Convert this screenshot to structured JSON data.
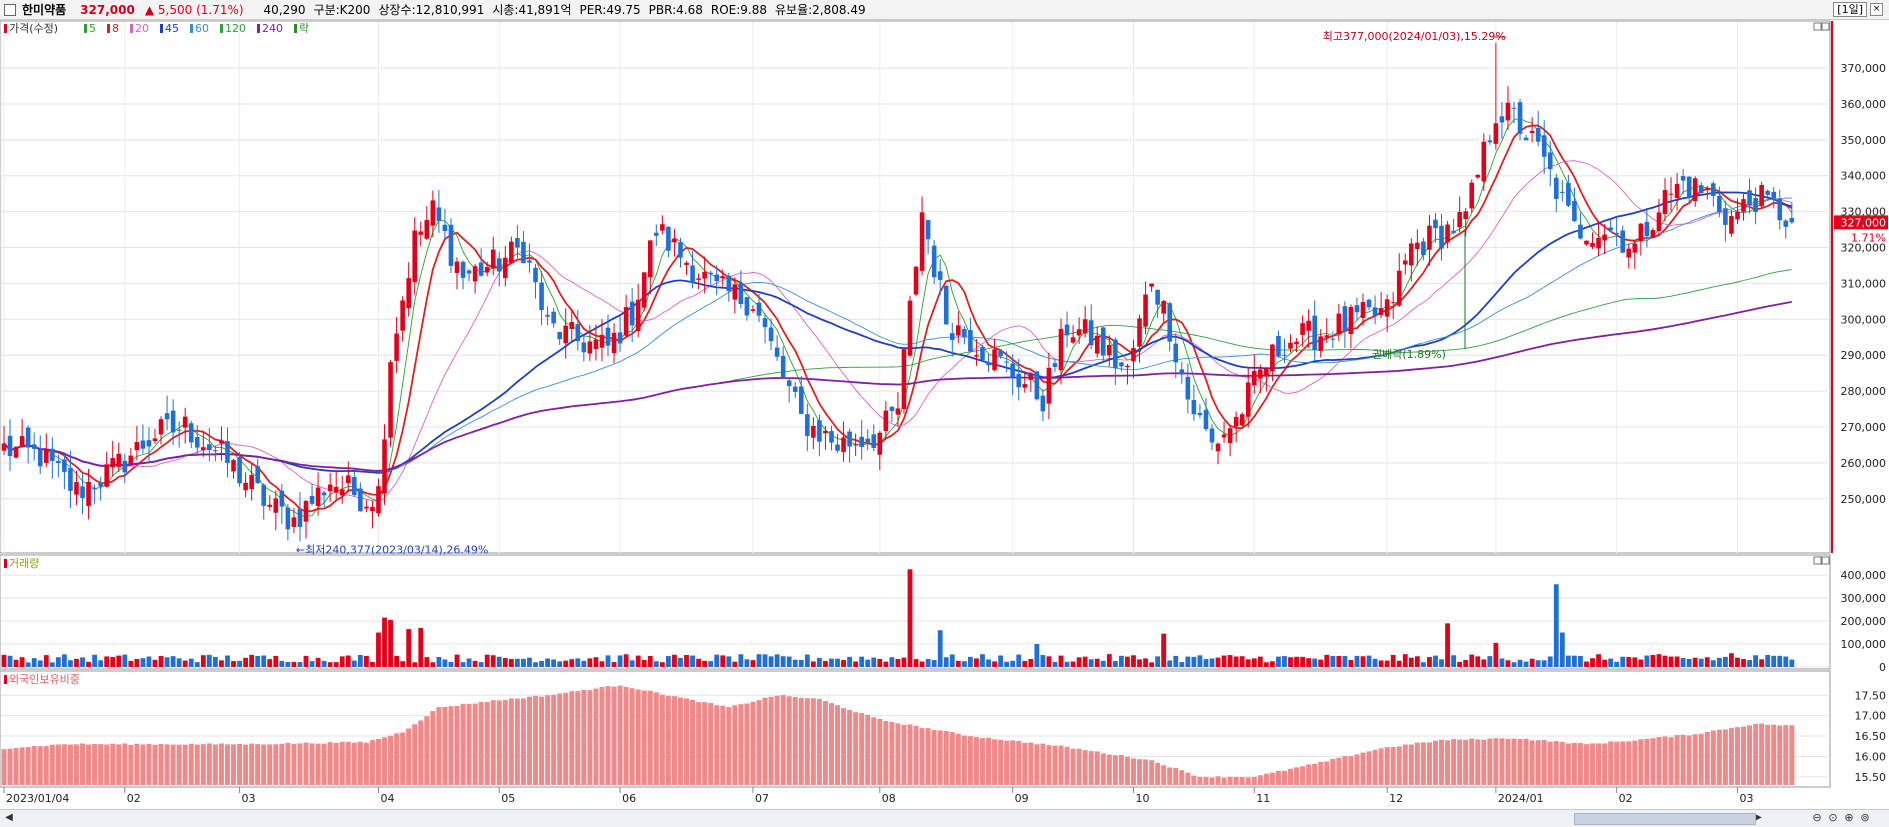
{
  "header": {
    "name": "한미약품",
    "price": "327,000",
    "change": "▲ 5,500",
    "change_pct": "(1.71%)",
    "volume": "40,290",
    "category": "구분:K200",
    "shares": "상장수:12,810,991",
    "market_cap": "시총:41,891억",
    "per": "PER:49.75",
    "pbr": "PBR:4.68",
    "roe": "ROE:9.88",
    "float_ratio": "유보율:2,808.49",
    "period": "[1일]"
  },
  "legend": {
    "price_label": "가격(수정)",
    "ma": [
      {
        "label": "5",
        "color": "#2ca02c"
      },
      {
        "label": "8",
        "color": "#e02020"
      },
      {
        "label": "20",
        "color": "#e060c0"
      },
      {
        "label": "45",
        "color": "#1f3fbf"
      },
      {
        "label": "60",
        "color": "#3a8fd0"
      },
      {
        "label": "120",
        "color": "#30a040"
      },
      {
        "label": "240",
        "color": "#8020a0"
      }
    ],
    "lock_label": "락",
    "volume_label": "거래량",
    "foreign_label": "외국인보유비중"
  },
  "annotations": {
    "high": "최고377,000(2024/01/03),15.29%",
    "low": "←최저240,377(2023/03/14),26.49%",
    "rights": "권배락(1.89%)",
    "last_price_tag": "327,000",
    "last_pct_tag": "1.71%"
  },
  "colors": {
    "up": "#e3001b",
    "down": "#1f6fd6",
    "foreign_bar": "#f08a8a",
    "grid": "#e4e4e4"
  },
  "chart_data": [
    {
      "type": "candlestick",
      "title": "가격(수정)",
      "ylim": [
        236000,
        382000
      ],
      "yticks": [
        250000,
        260000,
        270000,
        280000,
        290000,
        300000,
        310000,
        320000,
        330000,
        340000,
        350000,
        360000,
        370000
      ],
      "ytick_labels": [
        "250,000",
        "260,000",
        "270,000",
        "280,000",
        "290,000",
        "300,000",
        "310,000",
        "320,000",
        "330,000",
        "340,000",
        "350,000",
        "360,000",
        "370,000"
      ],
      "xticks": [
        "2023/01/04",
        "02",
        "03",
        "04",
        "05",
        "06",
        "07",
        "08",
        "09",
        "10",
        "11",
        "12",
        "2024/01",
        "02",
        "03"
      ],
      "xtick_index": [
        0,
        20,
        39,
        62,
        82,
        102,
        124,
        145,
        167,
        187,
        207,
        229,
        247,
        267,
        287
      ],
      "n": 297,
      "anchors": [
        [
          0,
          264000
        ],
        [
          6,
          262000
        ],
        [
          12,
          252000
        ],
        [
          18,
          258000
        ],
        [
          25,
          268000
        ],
        [
          30,
          270000
        ],
        [
          36,
          262000
        ],
        [
          44,
          248000
        ],
        [
          48,
          244000
        ],
        [
          54,
          255000
        ],
        [
          60,
          250000
        ],
        [
          62,
          252000
        ],
        [
          64,
          290000
        ],
        [
          68,
          322000
        ],
        [
          71,
          330000
        ],
        [
          76,
          312000
        ],
        [
          82,
          316000
        ],
        [
          86,
          320000
        ],
        [
          90,
          298000
        ],
        [
          95,
          294000
        ],
        [
          100,
          292000
        ],
        [
          104,
          302000
        ],
        [
          108,
          325000
        ],
        [
          112,
          318000
        ],
        [
          118,
          308000
        ],
        [
          124,
          305000
        ],
        [
          128,
          288000
        ],
        [
          132,
          272000
        ],
        [
          138,
          265000
        ],
        [
          145,
          268000
        ],
        [
          148,
          275000
        ],
        [
          152,
          330000
        ],
        [
          156,
          300000
        ],
        [
          162,
          292000
        ],
        [
          167,
          285000
        ],
        [
          172,
          278000
        ],
        [
          176,
          298000
        ],
        [
          180,
          295000
        ],
        [
          186,
          285000
        ],
        [
          190,
          312000
        ],
        [
          193,
          298000
        ],
        [
          196,
          278000
        ],
        [
          200,
          265000
        ],
        [
          204,
          272000
        ],
        [
          208,
          285000
        ],
        [
          212,
          294000
        ],
        [
          218,
          296000
        ],
        [
          224,
          300000
        ],
        [
          229,
          302000
        ],
        [
          233,
          320000
        ],
        [
          238,
          324000
        ],
        [
          242,
          328000
        ],
        [
          247,
          358000
        ],
        [
          250,
          356000
        ],
        [
          254,
          347000
        ],
        [
          256,
          340000
        ],
        [
          260,
          325000
        ],
        [
          266,
          325000
        ],
        [
          270,
          320000
        ],
        [
          274,
          332000
        ],
        [
          278,
          338000
        ],
        [
          282,
          335000
        ],
        [
          286,
          328000
        ],
        [
          290,
          334000
        ],
        [
          294,
          330000
        ],
        [
          296,
          327000
        ]
      ],
      "high": {
        "index": 247,
        "value": 377000,
        "date": "2024/01/03"
      },
      "low": {
        "index": 48,
        "value": 240377,
        "date": "2023/03/14"
      },
      "last": 327000,
      "series_ma": [
        {
          "name": "5",
          "period": 5,
          "color": "#2ca02c",
          "width": 0.9
        },
        {
          "name": "8",
          "period": 8,
          "color": "#e02020",
          "width": 1.8
        },
        {
          "name": "20",
          "period": 20,
          "color": "#e060c0",
          "width": 0.9
        },
        {
          "name": "45",
          "period": 45,
          "color": "#1f3fbf",
          "width": 1.8
        },
        {
          "name": "60",
          "period": 60,
          "color": "#3a8fd0",
          "width": 0.9
        },
        {
          "name": "120",
          "period": 120,
          "color": "#30a040",
          "width": 0.9
        },
        {
          "name": "240",
          "period": 240,
          "color": "#8020a0",
          "width": 1.8
        }
      ]
    },
    {
      "type": "bar",
      "title": "거래량",
      "ylim": [
        0,
        470000
      ],
      "yticks": [
        0,
        100000,
        200000,
        300000,
        400000
      ],
      "ytick_labels": [
        "0",
        "100,000",
        "200,000",
        "300,000",
        "400,000"
      ],
      "base": 40000,
      "spikes": [
        [
          62,
          150000
        ],
        [
          63,
          215000
        ],
        [
          64,
          205000
        ],
        [
          67,
          165000
        ],
        [
          69,
          170000
        ],
        [
          150,
          425000
        ],
        [
          155,
          160000
        ],
        [
          171,
          100000
        ],
        [
          192,
          145000
        ],
        [
          239,
          190000
        ],
        [
          247,
          105000
        ],
        [
          257,
          360000
        ],
        [
          258,
          150000
        ],
        [
          286,
          60000
        ]
      ]
    },
    {
      "type": "bar",
      "title": "외국인보유비중",
      "ylim": [
        15.3,
        17.85
      ],
      "yticks": [
        15.5,
        16.0,
        16.5,
        17.0,
        17.5
      ],
      "ytick_labels": [
        "15.50",
        "16.00",
        "16.50",
        "17.00",
        "17.50"
      ],
      "anchors": [
        [
          0,
          16.2
        ],
        [
          10,
          16.3
        ],
        [
          40,
          16.3
        ],
        [
          60,
          16.35
        ],
        [
          66,
          16.6
        ],
        [
          72,
          17.2
        ],
        [
          80,
          17.35
        ],
        [
          90,
          17.5
        ],
        [
          102,
          17.75
        ],
        [
          110,
          17.5
        ],
        [
          120,
          17.2
        ],
        [
          128,
          17.5
        ],
        [
          135,
          17.4
        ],
        [
          145,
          16.9
        ],
        [
          160,
          16.5
        ],
        [
          175,
          16.25
        ],
        [
          190,
          15.9
        ],
        [
          198,
          15.5
        ],
        [
          207,
          15.5
        ],
        [
          218,
          15.85
        ],
        [
          228,
          16.2
        ],
        [
          238,
          16.4
        ],
        [
          250,
          16.45
        ],
        [
          262,
          16.3
        ],
        [
          270,
          16.4
        ],
        [
          280,
          16.55
        ],
        [
          290,
          16.8
        ],
        [
          296,
          16.75
        ]
      ]
    }
  ]
}
